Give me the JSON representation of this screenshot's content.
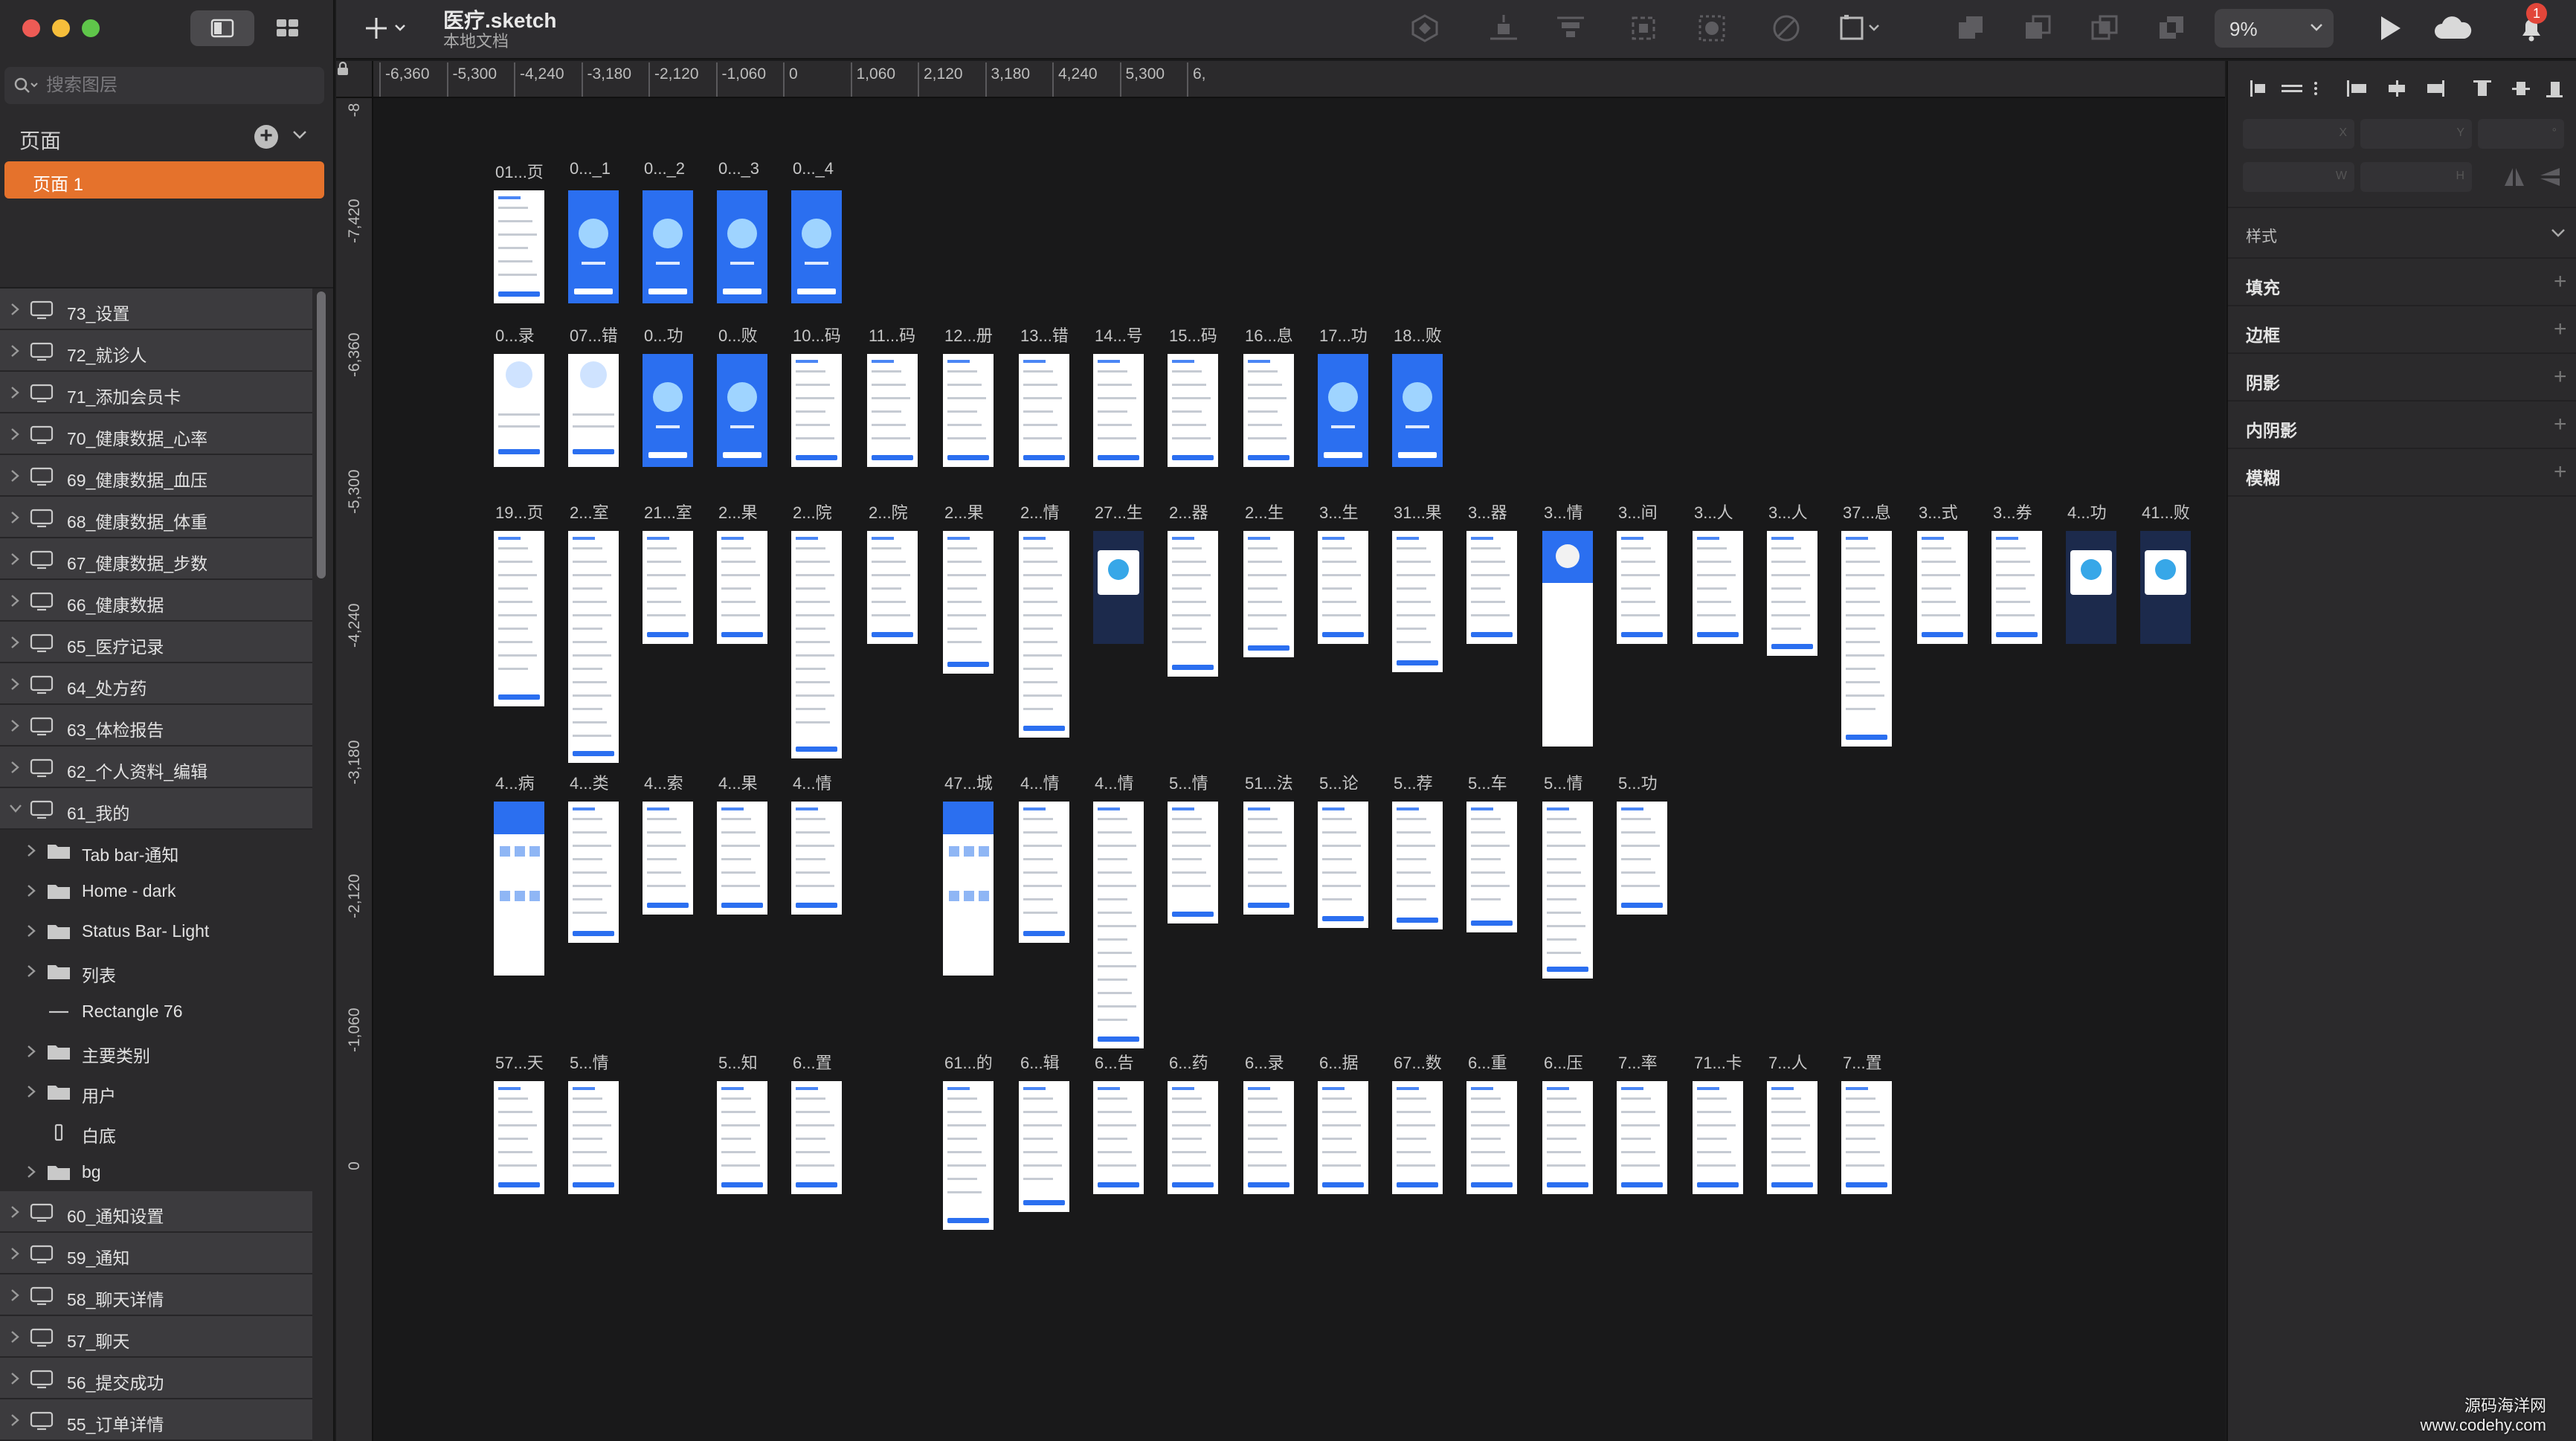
{
  "app": {
    "document_title": "医疗.sketch",
    "document_subtitle": "本地文档",
    "zoom": "9%",
    "notification_count": "1"
  },
  "sidebar": {
    "search_placeholder": "搜索图层",
    "pages_title": "页面",
    "pages": [
      {
        "label": "页面 1",
        "selected": true
      }
    ],
    "layers": [
      {
        "name": "73_设置",
        "type": "artboard",
        "expanded": false
      },
      {
        "name": "72_就诊人",
        "type": "artboard",
        "expanded": false
      },
      {
        "name": "71_添加会员卡",
        "type": "artboard",
        "expanded": false
      },
      {
        "name": "70_健康数据_心率",
        "type": "artboard",
        "expanded": false
      },
      {
        "name": "69_健康数据_血压",
        "type": "artboard",
        "expanded": false
      },
      {
        "name": "68_健康数据_体重",
        "type": "artboard",
        "expanded": false
      },
      {
        "name": "67_健康数据_步数",
        "type": "artboard",
        "expanded": false
      },
      {
        "name": "66_健康数据",
        "type": "artboard",
        "expanded": false
      },
      {
        "name": "65_医疗记录",
        "type": "artboard",
        "expanded": false
      },
      {
        "name": "64_处方药",
        "type": "artboard",
        "expanded": false
      },
      {
        "name": "63_体检报告",
        "type": "artboard",
        "expanded": false
      },
      {
        "name": "62_个人资料_编辑",
        "type": "artboard",
        "expanded": false
      },
      {
        "name": "61_我的",
        "type": "artboard",
        "expanded": true
      },
      {
        "name": "Tab bar-通知",
        "type": "group",
        "sub": true
      },
      {
        "name": "Home - dark",
        "type": "group",
        "sub": true
      },
      {
        "name": "Status Bar- Light",
        "type": "group",
        "sub": true
      },
      {
        "name": "列表",
        "type": "group",
        "sub": true
      },
      {
        "name": "Rectangle 76",
        "type": "line",
        "sub": true
      },
      {
        "name": "主要类别",
        "type": "group",
        "sub": true
      },
      {
        "name": "用户",
        "type": "group",
        "sub": true
      },
      {
        "name": "白底",
        "type": "rect",
        "sub": true
      },
      {
        "name": "bg",
        "type": "group",
        "sub": true
      },
      {
        "name": "60_通知设置",
        "type": "artboard",
        "expanded": false
      },
      {
        "name": "59_通知",
        "type": "artboard",
        "expanded": false
      },
      {
        "name": "58_聊天详情",
        "type": "artboard",
        "expanded": false
      },
      {
        "name": "57_聊天",
        "type": "artboard",
        "expanded": false
      },
      {
        "name": "56_提交成功",
        "type": "artboard",
        "expanded": false
      },
      {
        "name": "55_订单详情",
        "type": "artboard",
        "expanded": false
      }
    ]
  },
  "ruler": {
    "top": [
      "-6,360",
      "-5,300",
      "-4,240",
      "-3,180",
      "-2,120",
      "-1,060",
      "0",
      "1,060",
      "2,120",
      "3,180",
      "4,240",
      "5,300",
      "6,"
    ],
    "left": [
      "-8",
      "-7,420",
      "-6,360",
      "-5,300",
      "-4,240",
      "-3,180",
      "-2,120",
      "-1,060",
      "0"
    ]
  },
  "canvas": {
    "rows": [
      {
        "labels": [
          "01...页",
          "0..._1",
          "0..._2",
          "0..._3",
          "0..._4"
        ]
      },
      {
        "labels": [
          "0...录",
          "07...错",
          "0...功",
          "0...败",
          "10...码",
          "11...码",
          "12...册",
          "13...错",
          "14...号",
          "15...码",
          "16...息",
          "17...功",
          "18...败"
        ]
      },
      {
        "labels": [
          "19...页",
          "2...室",
          "21...室",
          "2...果",
          "2...院",
          "2...院",
          "2...果",
          "2...情",
          "27...生",
          "2...器",
          "2...生",
          "3...生",
          "31...果",
          "3...器",
          "3...情",
          "3...间",
          "3...人",
          "3...人",
          "37...息",
          "3...式",
          "3...券",
          "4...功",
          "41...败"
        ]
      },
      {
        "labels": [
          "4...病",
          "4...类",
          "4...索",
          "4...果",
          "4...情",
          "47...城",
          "4...情",
          "4...情",
          "5...情",
          "51...法",
          "5...论",
          "5...荐",
          "5...车",
          "5...情",
          "5...功"
        ]
      },
      {
        "labels": [
          "57...天",
          "5...情",
          "5...知",
          "6...置",
          "61...的",
          "6...辑",
          "6...告",
          "6...药",
          "6...录",
          "6...据",
          "67...数",
          "6...重",
          "6...压",
          "7...率",
          "71...卡",
          "7...人",
          "7...置"
        ]
      }
    ],
    "artboard_colors": {
      "blue": "#2b6ff0",
      "white": "#ffffff",
      "dark": "#1c2a4c"
    }
  },
  "inspector": {
    "field_labels": {
      "x": "X",
      "y": "Y",
      "rotation": "°",
      "w": "W",
      "h": "H"
    },
    "style_label": "样式",
    "sections": [
      "填充",
      "边框",
      "阴影",
      "内阴影",
      "模糊"
    ]
  },
  "watermark": {
    "line1": "源码海洋网",
    "line2": "www.codehy.com"
  }
}
